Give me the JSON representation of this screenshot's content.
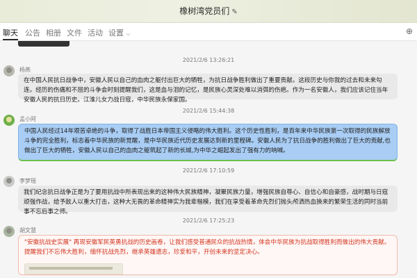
{
  "window": {
    "title": "橡树湾党员们"
  },
  "tabs": [
    {
      "label": "聊天"
    },
    {
      "label": "公告"
    },
    {
      "label": "相册"
    },
    {
      "label": "文件"
    },
    {
      "label": "活动"
    },
    {
      "label": "设置"
    }
  ],
  "messages": [
    {
      "timestamp": "2021/2/6 13:26:21",
      "sender": "杨燕",
      "text": "在中国人民抗日战争中，安徽人民以自己的血肉之躯付出巨大的牺牲，为抗日战争胜利做出了重要贡献。这段历史与你我的过去和未来勾连。经历的伤痛和不屈的斗争会时刻提醒我们，这是血与泪的记忆，是民族心灵深处难以消弭的伤疤。作为一名安徽人，我们应该记住当年安徽人民的抗日历史。江淮儿女力战日寇，中华民族永保家国。"
    },
    {
      "timestamp": "2021/2/6 15:44:38",
      "sender": "孟小阿",
      "text": "中国人民经过14年艰苦卓绝的斗争，取得了战胜日本帝国主义侵略的伟大胜利。这个历史性胜利，是百年来中华民族第一次取得的民族解放斗争的完全胜利，标志着中华民族的新觉醒，是中华民族近代历史发展达到新的里程碑。安徽人民为了抗日战争的胜利做出了巨大的贡献,也做出了巨大的牺牲，安徽人民以自己的血肉之躯筑起了新的长城,为中华之崛起发出了强有力的呐喊。"
    },
    {
      "timestamp": "2021/2/6 17:10:59",
      "sender": "李梦瑶",
      "text": "我们纪念抗日战争正是为了要用抗战中所表现出来的这种伟大民族精神，凝聚民族力量，增强民族自尊心、自信心和自豪感，战时期与日寇顽强作战，给予敌人以重大打击，这种大无畏的革命精神实为我辈楷模，我们在享受着革命先烈们抛头颅洒热血换来的繁荣生活的同时当前事不忘后事之师。"
    },
    {
      "timestamp": "2021/2/6 17:25:23",
      "sender": "胡文慧",
      "text": "\"安徽抗战史实展\" 再现安徽军民英勇抗战的历史画卷，让我们感受普通民众的抗战热情，体会中华民族为抗战取得胜利而做出的伟大贡献。提醒我们不忘伟大胜利，缅怀抗战先烈，继承英雄遗志，珍爱和平，开创未来的坚定决心。"
    }
  ],
  "colors": {
    "bubble_default": "#e9e9e9",
    "bubble_self": "#a9cdf4",
    "highlight_text": "#d2341f"
  }
}
